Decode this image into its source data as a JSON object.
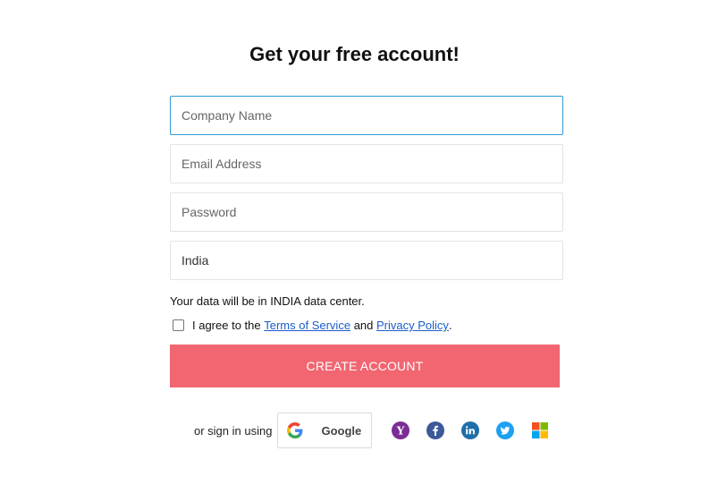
{
  "page": {
    "title": "Get your free account!"
  },
  "form": {
    "company_placeholder": "Company Name",
    "email_placeholder": "Email Address",
    "password_placeholder": "Password",
    "country_value": "India"
  },
  "notes": {
    "data_center": "Your data will be in INDIA data center.",
    "agree_prefix": "I agree to the",
    "terms_link": "Terms of Service",
    "and_text": "and",
    "privacy_link": "Privacy Policy",
    "period": "."
  },
  "actions": {
    "create_account": "CREATE ACCOUNT"
  },
  "social": {
    "signin_label": "or sign in using",
    "google_label": "Google",
    "icons": [
      "google-icon",
      "yahoo-icon",
      "facebook-icon",
      "linkedin-icon",
      "twitter-icon",
      "microsoft-icon"
    ]
  },
  "colors": {
    "accent_button": "#f26672",
    "focus_border": "#2f9bd4",
    "link": "#1a5dc9"
  }
}
